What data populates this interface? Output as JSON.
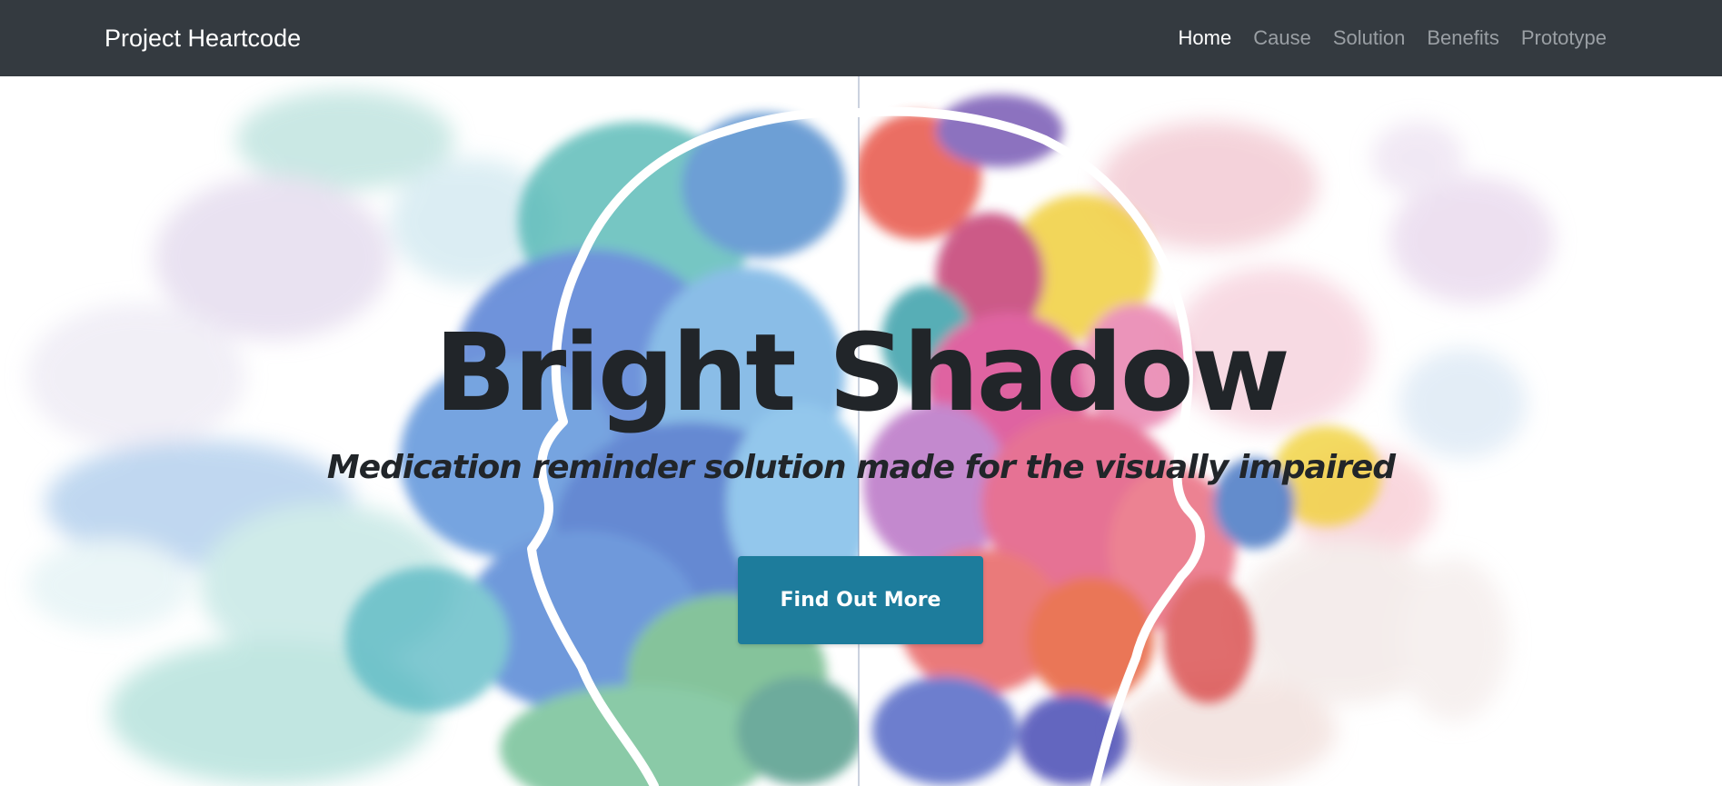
{
  "navbar": {
    "brand": "Project Heartcode",
    "links": [
      {
        "label": "Home",
        "active": true
      },
      {
        "label": "Cause",
        "active": false
      },
      {
        "label": "Solution",
        "active": false
      },
      {
        "label": "Benefits",
        "active": false
      },
      {
        "label": "Prototype",
        "active": false
      }
    ]
  },
  "hero": {
    "title": "Bright Shadow",
    "subtitle": "Medication reminder solution made for the visually impaired",
    "cta_label": "Find Out More",
    "background": "watercolor-head-illustration"
  },
  "colors": {
    "navbar_bg": "#343a40",
    "text_dark": "#212529",
    "cta_bg": "#1d7c9c"
  }
}
